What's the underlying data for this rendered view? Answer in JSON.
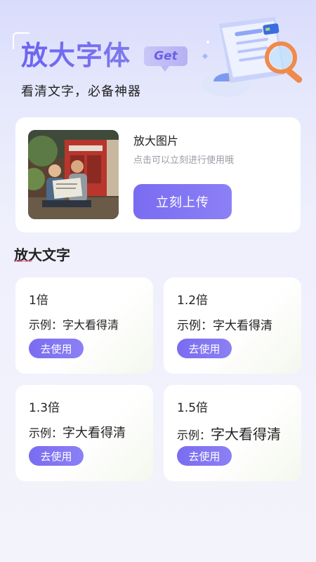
{
  "hero": {
    "title": "放大字体",
    "badge": "Get",
    "subtitle": "看清文字，必备神器"
  },
  "upload": {
    "title": "放大图片",
    "description": "点击可以立刻进行使用哦",
    "button_label": "立刻上传"
  },
  "section": {
    "title": "放大文字"
  },
  "options": [
    {
      "scale": "1倍",
      "example_label": "示例：",
      "example_text": "字大看得清",
      "button_label": "去使用"
    },
    {
      "scale": "1.2倍",
      "example_label": "示例：",
      "example_text": "字大看得清",
      "button_label": "去使用"
    },
    {
      "scale": "1.3倍",
      "example_label": "示例：",
      "example_text": "字大看得清",
      "button_label": "去使用"
    },
    {
      "scale": "1.5倍",
      "example_label": "示例：",
      "example_text": "字大看得清",
      "button_label": "去使用"
    }
  ],
  "colors": {
    "accent": "#7a6cf1",
    "background": "#eff0fc",
    "title_gradient_start": "#6b63f2"
  }
}
